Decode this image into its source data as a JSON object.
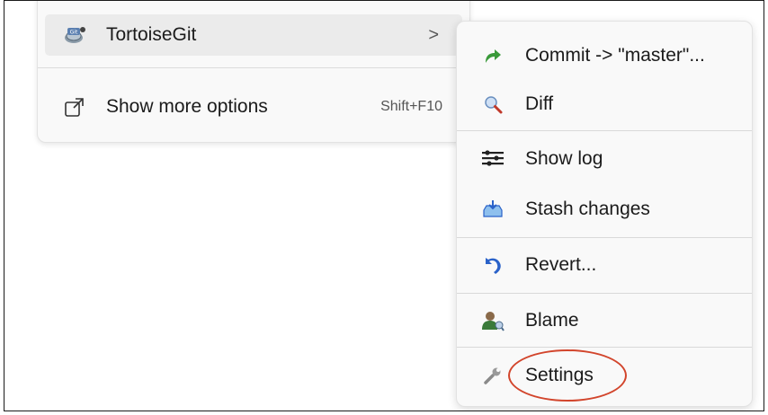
{
  "main_menu": {
    "items": [
      {
        "label": "TortoiseGit",
        "icon": "tortoisegit-icon",
        "chevron": ">"
      },
      {
        "label": "Show more options",
        "icon": "show-more-options-icon",
        "shortcut": "Shift+F10"
      }
    ]
  },
  "submenu": {
    "items": [
      {
        "label": "Commit -> \"master\"...",
        "icon": "commit-arrow-icon"
      },
      {
        "label": "Diff",
        "icon": "diff-magnifier-icon"
      },
      {
        "label": "Show log",
        "icon": "show-log-icon"
      },
      {
        "label": "Stash changes",
        "icon": "stash-changes-icon"
      },
      {
        "label": "Revert...",
        "icon": "revert-icon"
      },
      {
        "label": "Blame",
        "icon": "blame-icon"
      },
      {
        "label": "Settings",
        "icon": "wrench-icon"
      }
    ]
  },
  "annotation": {
    "highlighted_item": "Settings",
    "ring_color": "#d2452c"
  },
  "colors": {
    "menu_bg": "#f9f9f9",
    "hover_bg": "#ebebeb",
    "text": "#1b1b1b",
    "commit_green": "#3a9a3a",
    "blue": "#2a62c9"
  }
}
